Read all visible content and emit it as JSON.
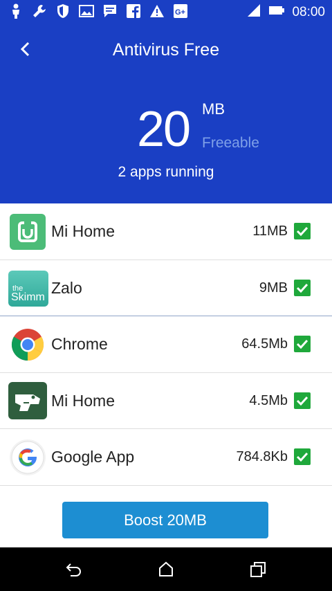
{
  "status_bar": {
    "time": "08:00",
    "left_icons": [
      "person-icon",
      "wrench-icon",
      "shield-icon",
      "image-icon",
      "message-icon",
      "facebook-icon",
      "warning-icon",
      "google-plus-icon"
    ],
    "right_icons": [
      "signal-icon",
      "battery-icon"
    ]
  },
  "header": {
    "title": "Antivirus Free",
    "freeable_amount": "20",
    "unit": "MB",
    "freeable_label": "Freeable",
    "apps_running": "2 apps running",
    "background_color": "#1a3fc4"
  },
  "apps": [
    {
      "name": "Mi Home",
      "size": "11MB",
      "icon": "mi-home-icon",
      "checked": true
    },
    {
      "name": "Zalo",
      "size": "9MB",
      "icon": "the-skimm-icon",
      "icon_text_small": "the",
      "icon_text": "Skimm",
      "checked": true
    },
    {
      "name": "Chrome",
      "size": "64.5Mb",
      "icon": "chrome-icon",
      "checked": true
    },
    {
      "name": "Mi Home",
      "size": "4.5Mb",
      "icon": "dinosaur-icon",
      "checked": true
    },
    {
      "name": "Google App",
      "size": "784.8Kb",
      "icon": "google-icon",
      "checked": true
    }
  ],
  "boost_button": {
    "label": "Boost 20MB",
    "color": "#1d8ed2"
  },
  "check_color": "#1fa83b",
  "nav_bar": {
    "icons": [
      "back-icon",
      "home-icon",
      "recents-icon"
    ]
  }
}
